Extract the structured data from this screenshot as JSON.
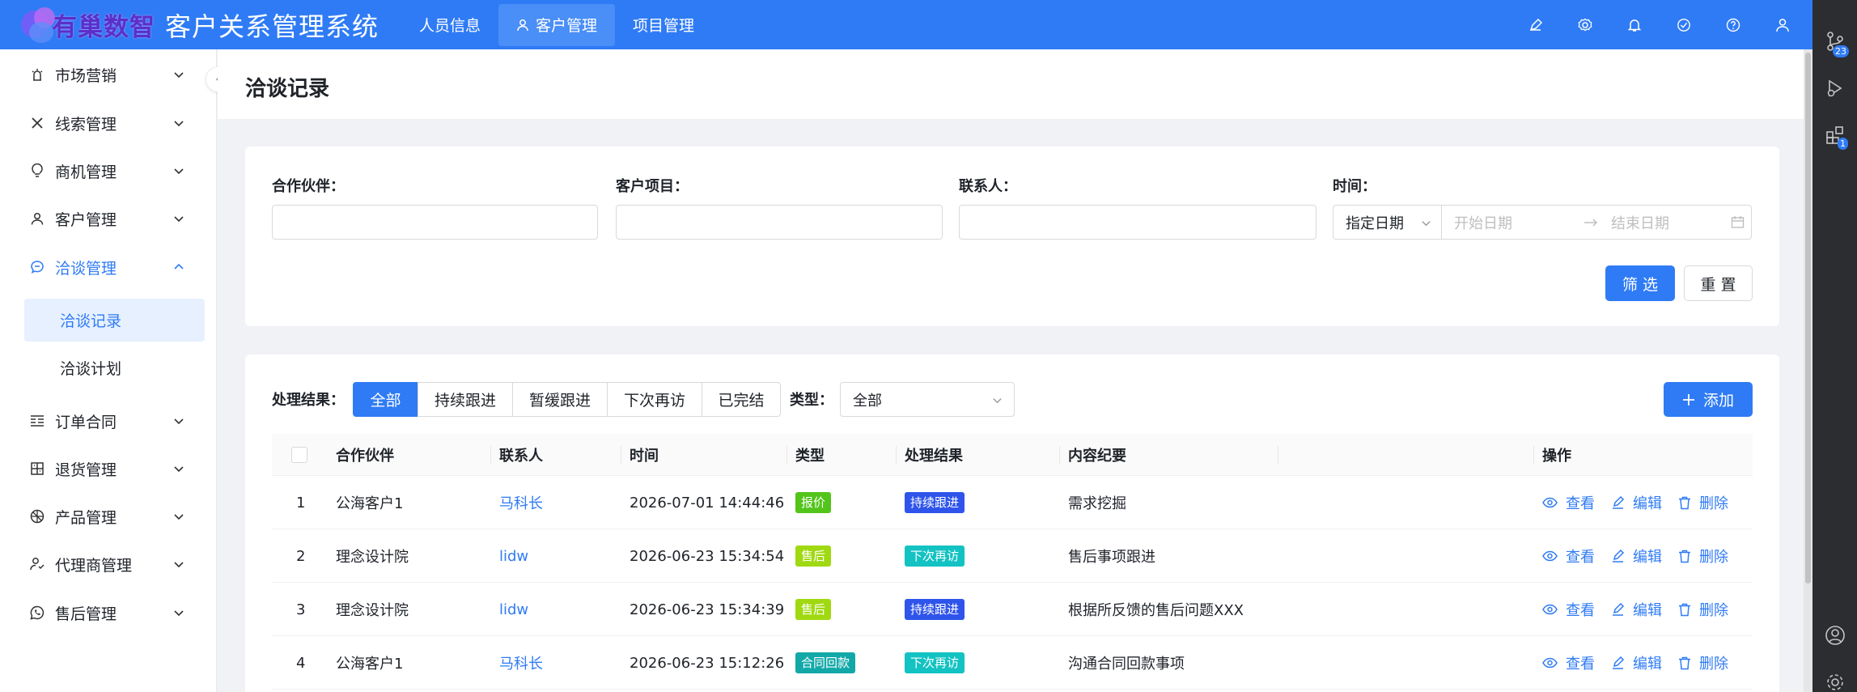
{
  "header": {
    "logo_text": "有巢数智",
    "app_title": "客户关系管理系统",
    "nav": [
      {
        "label": "人员信息",
        "active": false
      },
      {
        "label": "客户管理",
        "active": true
      },
      {
        "label": "项目管理",
        "active": false
      }
    ],
    "icons": [
      "pen-icon",
      "gear-icon",
      "bell-icon",
      "check-circle-icon",
      "help-icon",
      "user-icon"
    ]
  },
  "side_strip": {
    "badges": [
      "23",
      "1"
    ]
  },
  "sidebar": {
    "items": [
      {
        "label": "市场营销",
        "icon": "campaign-icon",
        "open": false
      },
      {
        "label": "线索管理",
        "icon": "x-logo-icon",
        "open": false
      },
      {
        "label": "商机管理",
        "icon": "lightbulb-icon",
        "open": false
      },
      {
        "label": "客户管理",
        "icon": "user-icon",
        "open": false
      },
      {
        "label": "洽谈管理",
        "icon": "chat-icon",
        "open": true
      },
      {
        "label": "订单合同",
        "icon": "list-icon",
        "open": false
      },
      {
        "label": "退货管理",
        "icon": "grid-icon",
        "open": false
      },
      {
        "label": "产品管理",
        "icon": "product-icon",
        "open": false
      },
      {
        "label": "代理商管理",
        "icon": "agent-icon",
        "open": false
      },
      {
        "label": "售后管理",
        "icon": "whatsapp-icon",
        "open": false
      }
    ],
    "sub_items": [
      {
        "label": "洽谈记录",
        "active": true
      },
      {
        "label": "洽谈计划",
        "active": false
      }
    ]
  },
  "page": {
    "title": "洽谈记录"
  },
  "filter": {
    "partner_label": "合作伙伴：",
    "project_label": "客户项目：",
    "contact_label": "联系人：",
    "time_label": "时间：",
    "date_mode": "指定日期",
    "start_placeholder": "开始日期",
    "end_placeholder": "结束日期",
    "filter_button": "筛 选",
    "reset_button": "重 置"
  },
  "list": {
    "result_label": "处理结果：",
    "segments": [
      {
        "label": "全部",
        "active": true
      },
      {
        "label": "持续跟进",
        "active": false
      },
      {
        "label": "暂缓跟进",
        "active": false
      },
      {
        "label": "下次再访",
        "active": false
      },
      {
        "label": "已完结",
        "active": false
      }
    ],
    "type_label": "类型：",
    "type_value": "全部",
    "add_button": "添加",
    "columns": {
      "partner": "合作伙伴",
      "contact": "联系人",
      "time": "时间",
      "type": "类型",
      "result": "处理结果",
      "summary": "内容纪要",
      "actions": "操作"
    },
    "action_labels": {
      "view": "查看",
      "edit": "编辑",
      "delete": "删除"
    },
    "rows": [
      {
        "index": "1",
        "partner": "公海客户1",
        "contact": "马科长",
        "time": "2026-07-01 14:44:46",
        "type": "报价",
        "type_color": "#52c41a",
        "result": "持续跟进",
        "result_color": "#2f54eb",
        "summary": "需求挖掘"
      },
      {
        "index": "2",
        "partner": "理念设计院",
        "contact": "lidw",
        "time": "2026-06-23 15:34:54",
        "type": "售后",
        "type_color": "#a0d911",
        "result": "下次再访",
        "result_color": "#13c2c2",
        "summary": "售后事项跟进"
      },
      {
        "index": "3",
        "partner": "理念设计院",
        "contact": "lidw",
        "time": "2026-06-23 15:34:39",
        "type": "售后",
        "type_color": "#a0d911",
        "result": "持续跟进",
        "result_color": "#2f54eb",
        "summary": "根据所反馈的售后问题XXX"
      },
      {
        "index": "4",
        "partner": "公海客户1",
        "contact": "马科长",
        "time": "2026-06-23 15:12:26",
        "type": "合同回款",
        "type_color": "#13a8a8",
        "result": "下次再访",
        "result_color": "#13c2c2",
        "summary": "沟通合同回款事项"
      }
    ]
  }
}
